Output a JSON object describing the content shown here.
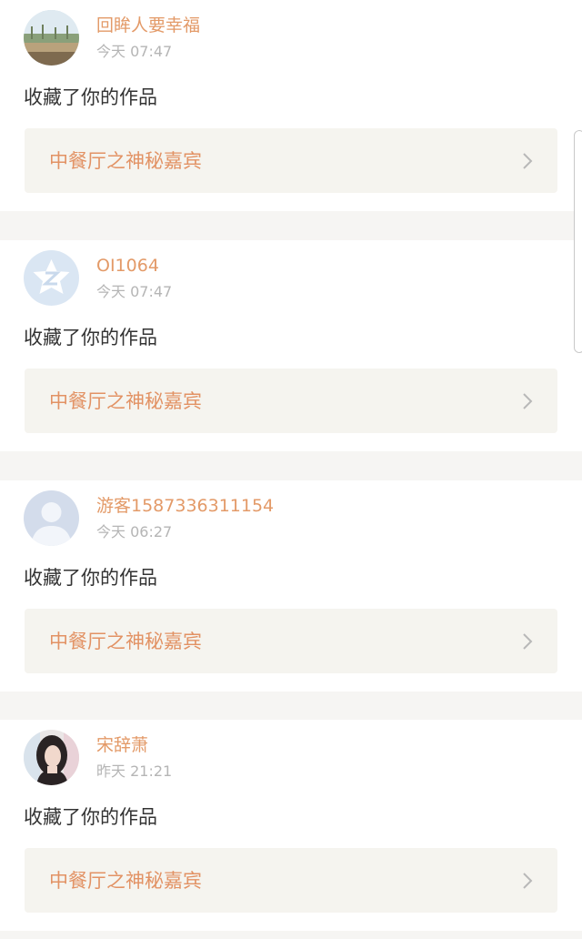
{
  "notifications": [
    {
      "user": "回眸人要幸福",
      "time": "今天 07:47",
      "action": "收藏了你的作品",
      "work_title": "中餐厅之神秘嘉宾",
      "avatar_icon": "landscape-photo-icon"
    },
    {
      "user": "OI1064",
      "time": "今天 07:47",
      "action": "收藏了你的作品",
      "work_title": "中餐厅之神秘嘉宾",
      "avatar_icon": "default-z-logo-icon"
    },
    {
      "user": "游客1587336311154",
      "time": "今天 06:27",
      "action": "收藏了你的作品",
      "work_title": "中餐厅之神秘嘉宾",
      "avatar_icon": "default-person-icon"
    },
    {
      "user": "宋辞萧",
      "time": "昨天 21:21",
      "action": "收藏了你的作品",
      "work_title": "中餐厅之神秘嘉宾",
      "avatar_icon": "portrait-photo-icon"
    }
  ],
  "colors": {
    "username": "#e39a68",
    "work_title": "#e29264",
    "link_background": "#f5f4ef",
    "page_background": "#f6f5f3"
  }
}
